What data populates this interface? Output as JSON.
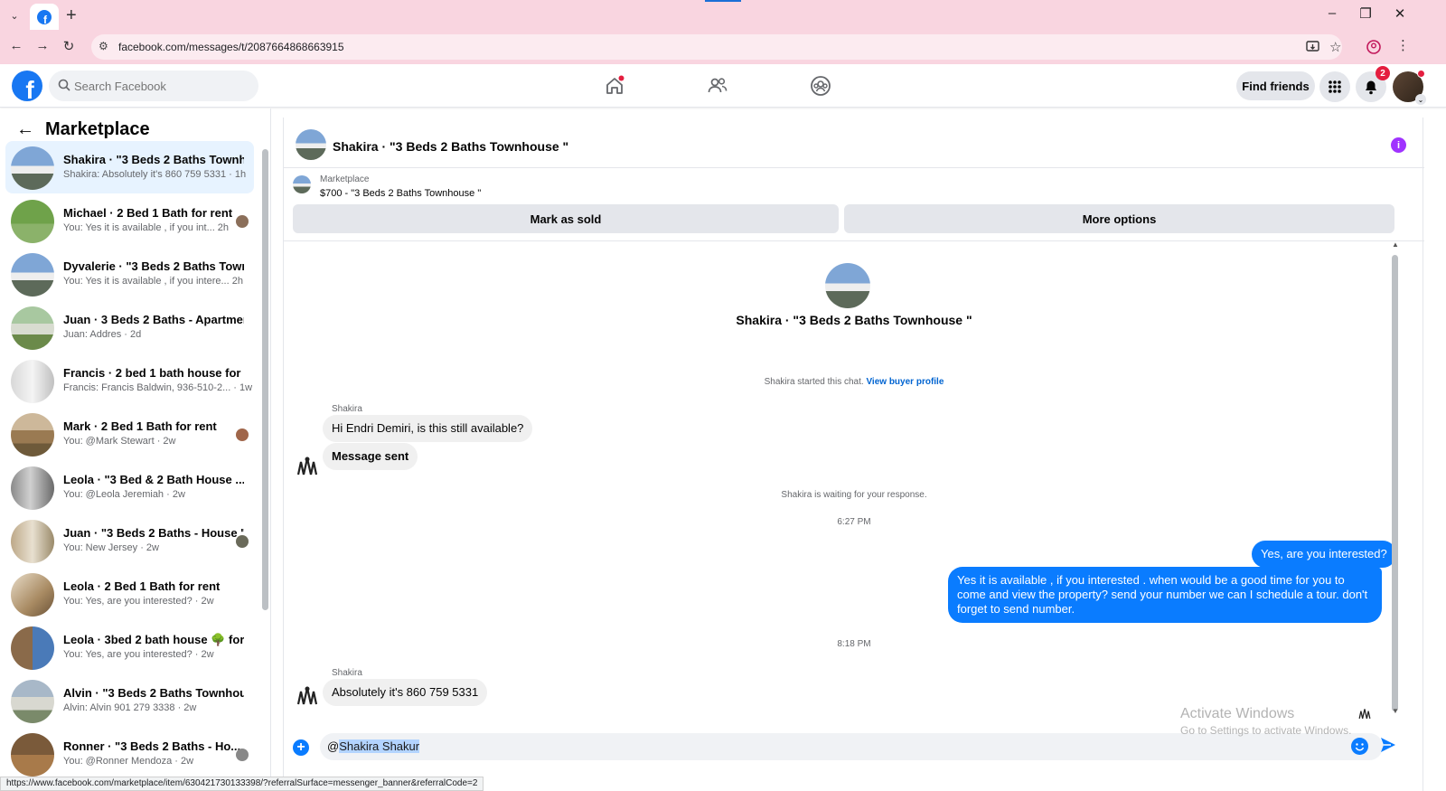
{
  "browser": {
    "url": "facebook.com/messages/t/2087664868663915",
    "status_url": "https://www.facebook.com/marketplace/item/630421730133398/?referralSurface=messenger_banner&referralCode=2"
  },
  "header": {
    "search_placeholder": "Search Facebook",
    "find_friends": "Find friends",
    "notif_count": "2"
  },
  "sidebar": {
    "title": "Marketplace",
    "items": [
      {
        "name": "Shakira · \"3 Beds 2 Baths Townh...",
        "sub": "Shakira: Absolutely it's 860 759 5331 · 1h"
      },
      {
        "name": "Michael · 2 Bed 1 Bath for rent",
        "sub": "You: Yes it is available , if you int...   2h"
      },
      {
        "name": "Dyvalerie · \"3 Beds 2 Baths Town...",
        "sub": "You: Yes it is available , if you intere...  2h"
      },
      {
        "name": "Juan · 3 Beds 2 Baths - Apartment",
        "sub": "Juan: Addres · 2d"
      },
      {
        "name": "Francis · 2 bed 1 bath house for ...",
        "sub": "Francis: Francis Baldwin, 936-510-2... · 1w"
      },
      {
        "name": "Mark · 2 Bed 1 Bath for rent",
        "sub": "You: @Mark Stewart · 2w"
      },
      {
        "name": "Leola · \"3 Bed & 2 Bath House ...",
        "sub": "You: @Leola Jeremiah · 2w"
      },
      {
        "name": "Juan · \"3 Beds 2 Baths - House \"",
        "sub": "You: New Jersey · 2w"
      },
      {
        "name": "Leola · 2 Bed 1 Bath for rent",
        "sub": "You: Yes, are you interested? · 2w"
      },
      {
        "name": "Leola · 3bed 2 bath house 🌳 for...",
        "sub": "You: Yes, are you interested? · 2w"
      },
      {
        "name": "Alvin · \"3 Beds 2 Baths Townhou...",
        "sub": "Alvin: Alvin 901 279 3338 · 2w"
      },
      {
        "name": "Ronner · \"3 Beds 2 Baths - Ho...",
        "sub": "You: @Ronner Mendoza · 2w"
      }
    ]
  },
  "chat": {
    "title": "Shakira · \"3 Beds 2 Baths Townhouse \"",
    "marketplace_label": "Marketplace",
    "listing": "$700 - \"3 Beds 2 Baths Townhouse \"",
    "mark_sold": "Mark as sold",
    "more_options": "More options",
    "center_title": "Shakira · \"3 Beds 2 Baths Townhouse \"",
    "started": "Shakira started this chat.",
    "view_profile": "View buyer profile",
    "sender": "Shakira",
    "msg1": "Hi Endri Demiri, is this still available?",
    "msg2": "Message sent",
    "waiting": "Shakira is waiting for your response.",
    "time1": "6:27 PM",
    "out1": "Yes, are you interested?",
    "out2": "Yes it is available , if you interested . when would be  a good time for you to come and view the  property? send your number we can I schedule  a tour. don't forget to send  number.",
    "time2": "8:18 PM",
    "sender2": "Shakira",
    "msg3": "Absolutely it's 860 759 5331",
    "composer_value": "Shakira Shakur",
    "composer_prefix": "@"
  },
  "watermark": {
    "line1": "Activate Windows",
    "line2": "Go to Settings to activate Windows."
  }
}
